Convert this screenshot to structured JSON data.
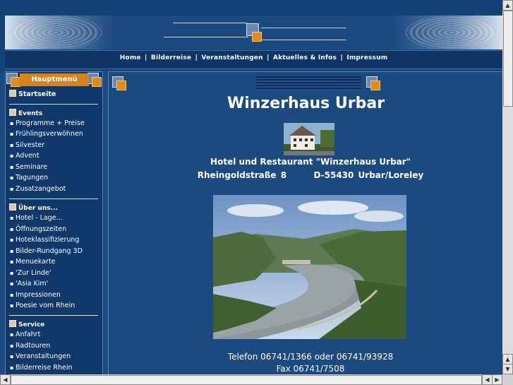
{
  "nav": {
    "links": [
      "Home",
      "Bilderreise",
      "Veranstaltungen",
      "Aktuelles & Infos",
      "Impressum"
    ],
    "separator": "|"
  },
  "sidebar": {
    "title": "Hauptmenü",
    "startseite": "Startseite",
    "sections": [
      {
        "title": "Events",
        "items": [
          "Programme + Preise",
          "Frühlingsverwöhnen",
          "Silvester",
          "Advent",
          "Seminare",
          "Tagungen",
          "Zusatzangebot"
        ]
      },
      {
        "title": "Über uns...",
        "items": [
          "Hotel - Lage...",
          "Öffnungszeiten",
          "Hoteklassifizierung",
          "Bilder-Rundgang 3D",
          "Menuekarte",
          "'Zur Linde'",
          "'Asia Kim'",
          "Impressionen",
          "Poesie vom Rhein"
        ]
      },
      {
        "title": "Service",
        "items": [
          "Anfahrt",
          "Radtouren",
          "Veranstaltungen",
          "Bilderreise Rhein"
        ]
      }
    ]
  },
  "main": {
    "title": "Winzerhaus Urbar",
    "hotel_line": "Hotel und Restaurant \"Winzerhaus Urbar\"",
    "street": "Rheingoldstraße 8",
    "city": "D-55430 Urbar/Loreley",
    "phone": "Telefon 06741/1366 oder 06741/93928",
    "fax": "Fax 06741/7508"
  },
  "colors": {
    "page_bg": "#1c4a7e",
    "accent_orange": "#d9811a",
    "nav_bg": "#0f3566"
  }
}
